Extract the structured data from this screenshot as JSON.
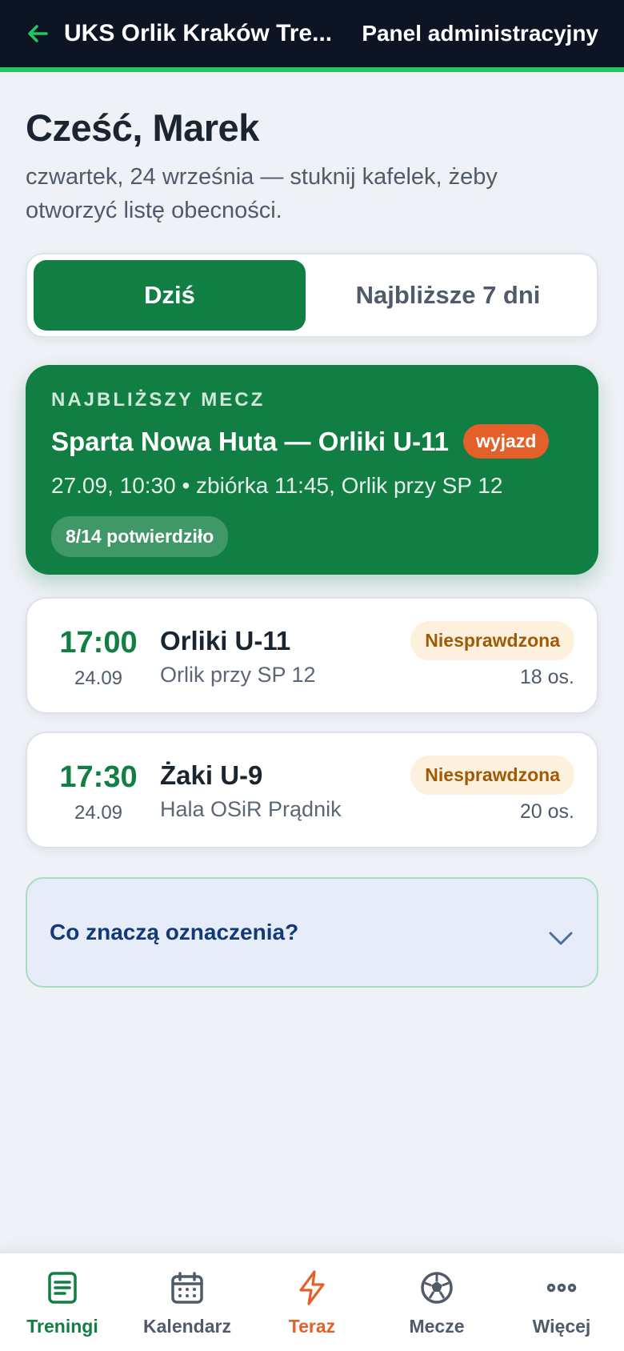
{
  "header": {
    "title": "UKS Orlik Kraków Tre...",
    "admin_link": "Panel administracyjny"
  },
  "greeting": {
    "title": "Cześć, Marek",
    "subtitle": "czwartek, 24 września — stuknij kafelek, żeby otworzyć listę obecności."
  },
  "tabs": [
    {
      "label": "Dziś",
      "active": true
    },
    {
      "label": "Najbliższe 7 dni",
      "active": false
    }
  ],
  "next_match": {
    "kicker": "NAJBLIŻSZY MECZ",
    "title": "Sparta Nowa Huta — Orliki U-11",
    "badge": "wyjazd",
    "meta": "27.09, 10:30 • zbiórka 11:45, Orlik przy SP 12",
    "confirmed": "8/14 potwierdziło"
  },
  "trainings": [
    {
      "time": "17:00",
      "date": "24.09",
      "group": "Orliki U-11",
      "place": "Orlik przy SP 12",
      "status": "Niesprawdzona",
      "count": "18 os."
    },
    {
      "time": "17:30",
      "date": "24.09",
      "group": "Żaki U-9",
      "place": "Hala OSiR Prądnik",
      "status": "Niesprawdzona",
      "count": "20 os."
    }
  ],
  "legend": {
    "title": "Co znaczą oznaczenia?"
  },
  "nav": [
    {
      "label": "Treningi",
      "icon": "clipboard-icon"
    },
    {
      "label": "Kalendarz",
      "icon": "calendar-icon"
    },
    {
      "label": "Teraz",
      "icon": "lightning-icon"
    },
    {
      "label": "Mecze",
      "icon": "soccer-ball-icon"
    },
    {
      "label": "Więcej",
      "icon": "more-dots-icon"
    }
  ],
  "colors": {
    "brand_green": "#117e43",
    "accent_orange": "#e4602a",
    "top_bar": "#0d1424",
    "status_bg": "#fdf0dc",
    "status_text": "#a05a07"
  }
}
